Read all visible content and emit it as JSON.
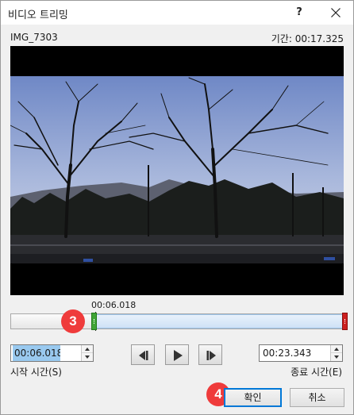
{
  "dialog": {
    "title": "비디오 트리밍",
    "help_label": "?"
  },
  "media": {
    "file_name": "IMG_7303",
    "duration_text": "기간: 00:17.325"
  },
  "timeline": {
    "current_time": "00:06.018",
    "selection_start_fraction": 0.26,
    "selection_end_fraction": 1.0
  },
  "trim": {
    "start_value": "00:06.018",
    "start_label": "시작 시간(S)",
    "end_value": "00:23.343",
    "end_label": "종료 시간(E)"
  },
  "playback": {
    "prev_frame_icon": "previous-frame-icon",
    "play_icon": "play-icon",
    "next_frame_icon": "next-frame-icon"
  },
  "buttons": {
    "ok": "확인",
    "cancel": "취소"
  },
  "annotations": {
    "step3": "3",
    "step4": "4"
  },
  "colors": {
    "badge": "#ef3b3b",
    "start_handle": "#3fa536",
    "end_handle": "#cc1f1f",
    "selection": "#cfe2f6"
  }
}
